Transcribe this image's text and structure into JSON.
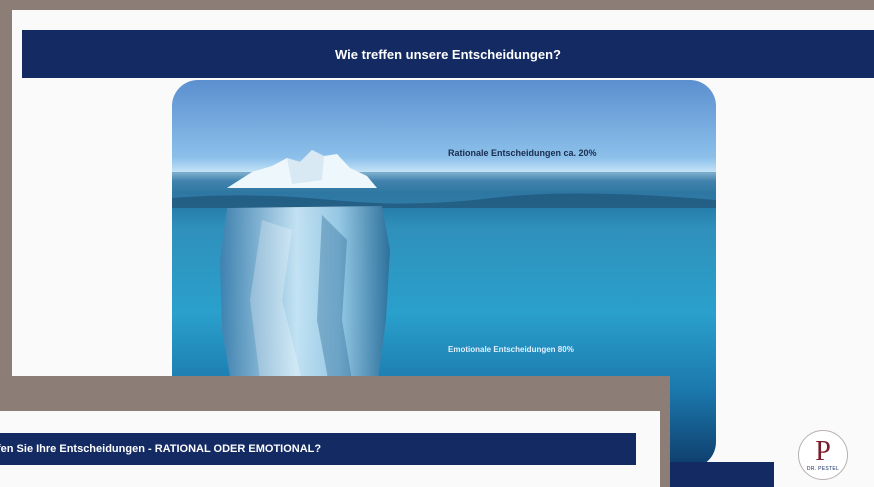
{
  "back_slide": {
    "title": "Wie treffen unsere Entscheidungen?",
    "rational_label": "Rationale Entscheidungen ca. 20%",
    "emotional_label": "Emotionale Entscheidungen 80%",
    "logo": {
      "letter": "P",
      "name": "DR. PESTEL"
    }
  },
  "front_slide": {
    "title": "fen Sie Ihre Entscheidungen - RATIONAL ODER EMOTIONAL?"
  },
  "colors": {
    "title_bar": "#132a63",
    "background_frame": "#8c7e76",
    "logo_letter": "#7a1d2a"
  }
}
